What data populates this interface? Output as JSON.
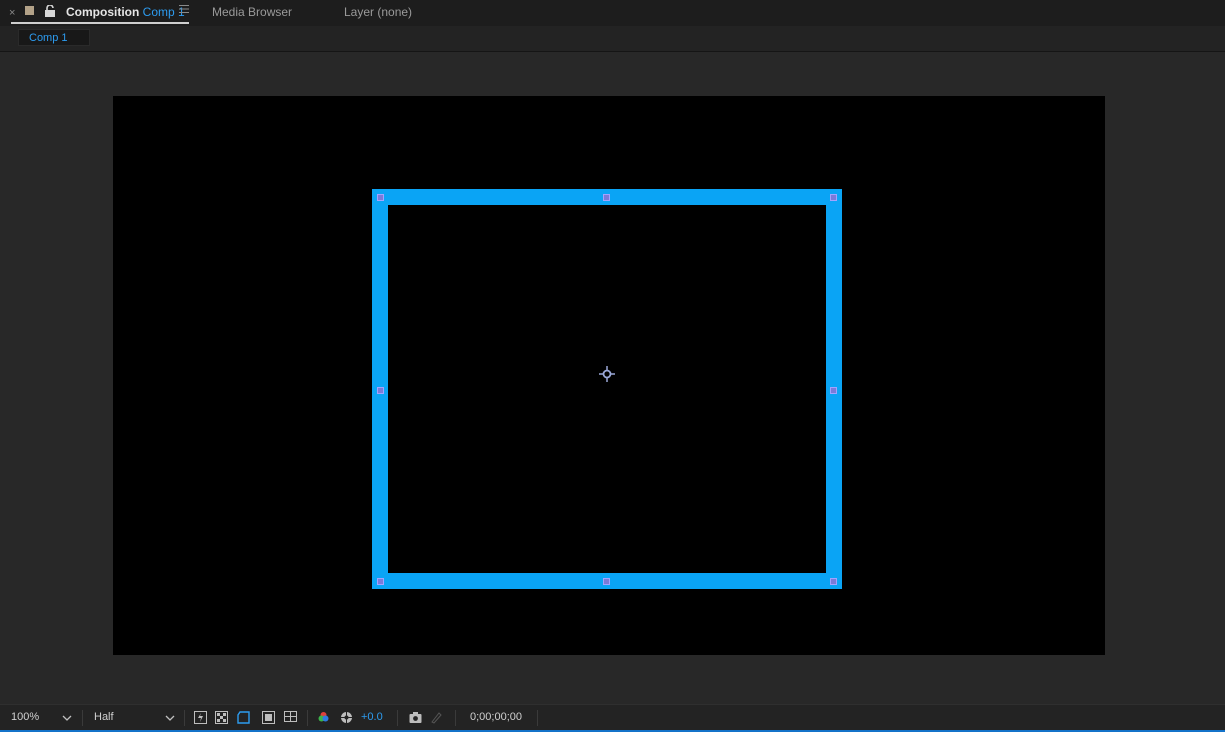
{
  "tabs": {
    "close_glyph": "×",
    "composition_label": "Composition",
    "composition_name": "Comp 1",
    "media_browser": "Media Browser",
    "layer": "Layer (none)"
  },
  "comp_tab": {
    "label": "Comp 1"
  },
  "colors": {
    "accent": "#2d9cf0",
    "shape_stroke": "#0aa4f5",
    "handle": "#7b7bd9",
    "canvas": "#000000",
    "background": "#282828"
  },
  "toolbar": {
    "zoom": "100%",
    "resolution": "Half",
    "exposure": "+0.0",
    "timecode": "0;00;00;00",
    "icons": [
      "fast-previews-icon",
      "transparency-grid-icon",
      "mask-visibility-icon",
      "region-of-interest-icon",
      "guides-icon",
      "channel-icon",
      "reset-exposure-icon",
      "snapshot-icon",
      "show-snapshot-icon"
    ]
  }
}
